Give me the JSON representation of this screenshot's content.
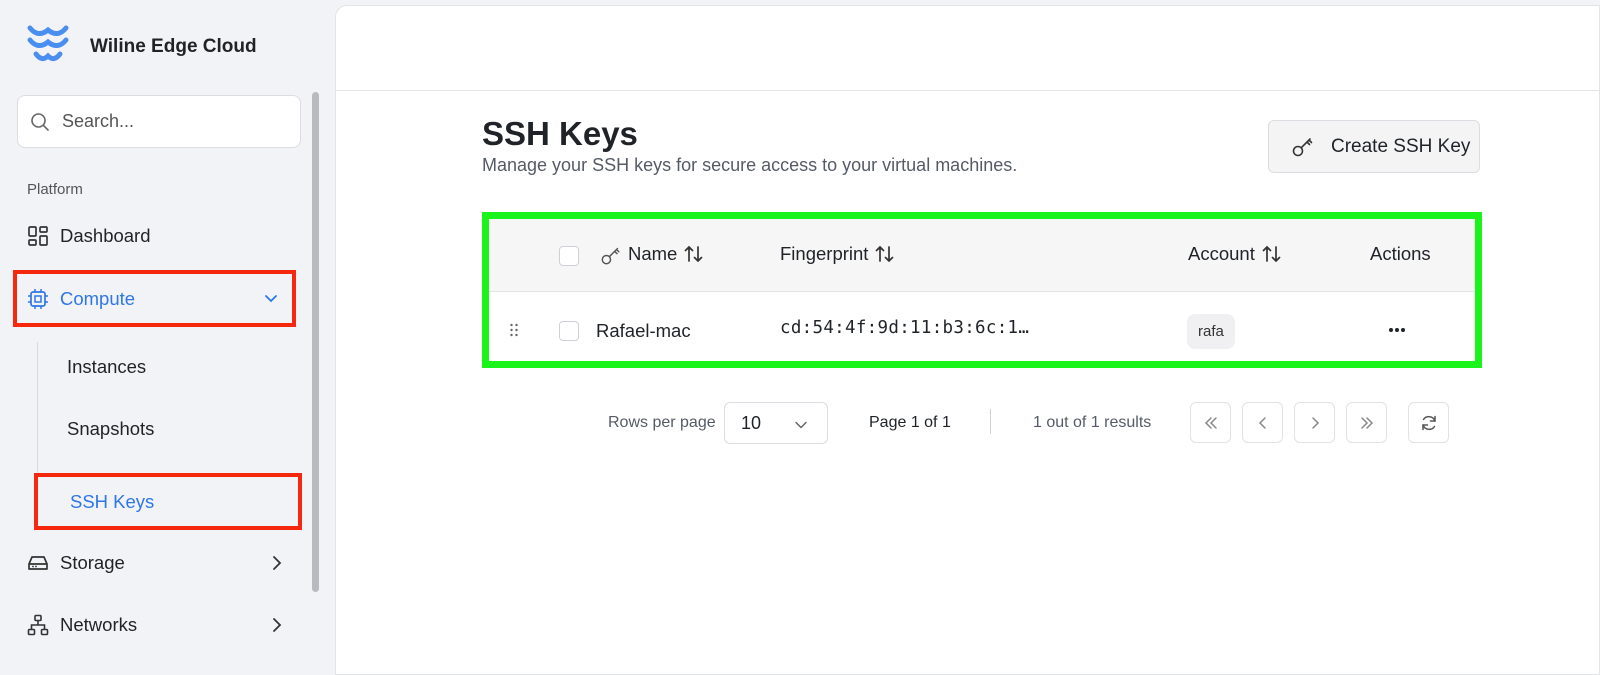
{
  "app": {
    "name": "Wiline Edge Cloud"
  },
  "search": {
    "placeholder": "Search..."
  },
  "sidebar": {
    "section_label": "Platform",
    "items": [
      {
        "label": "Dashboard",
        "icon": "dashboard-icon"
      },
      {
        "label": "Compute",
        "icon": "cpu-icon",
        "expanded": true
      },
      {
        "label": "Storage",
        "icon": "hard-drive-icon"
      },
      {
        "label": "Networks",
        "icon": "network-icon"
      }
    ],
    "compute_sub": [
      {
        "label": "Instances"
      },
      {
        "label": "Snapshots"
      },
      {
        "label": "SSH Keys",
        "active": true
      }
    ]
  },
  "page": {
    "title": "SSH Keys",
    "subtitle": "Manage your SSH keys for secure access to your virtual machines.",
    "create_button": "Create SSH Key"
  },
  "table": {
    "columns": [
      "Name",
      "Fingerprint",
      "Account",
      "Actions"
    ],
    "rows": [
      {
        "name": "Rafael-mac",
        "fingerprint": "cd:54:4f:9d:11:b3:6c:1…",
        "account": "rafa"
      }
    ]
  },
  "pagination": {
    "rows_per_page_label": "Rows per page",
    "rows_per_page": "10",
    "page_info": "Page 1 of 1",
    "results": "1 out of 1 results"
  },
  "colors": {
    "accent": "#2f76e6",
    "highlight_red": "#f5280d",
    "highlight_green": "#1bf41b"
  }
}
